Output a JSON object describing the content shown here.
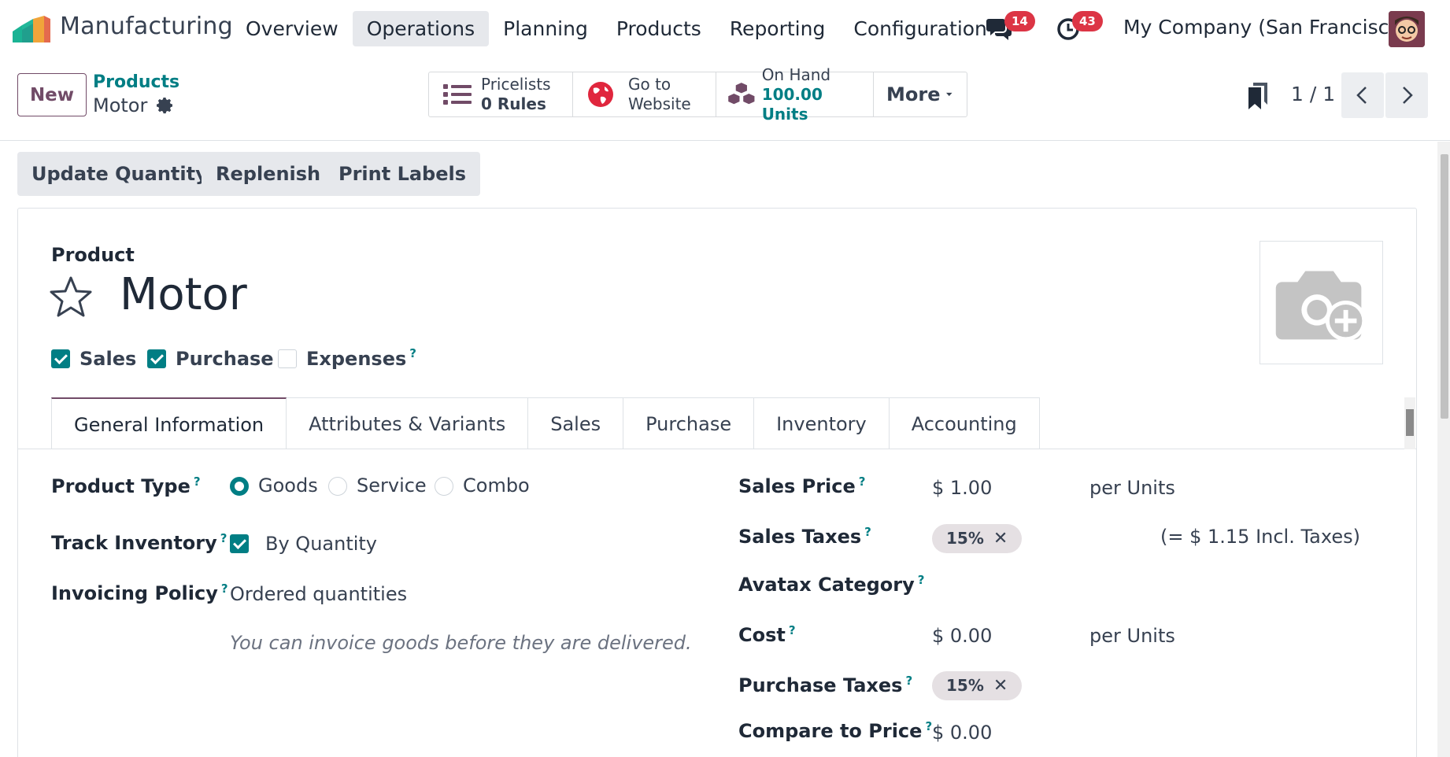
{
  "navbar": {
    "app_name": "Manufacturing",
    "menu": [
      {
        "label": "Overview",
        "active": false
      },
      {
        "label": "Operations",
        "active": true
      },
      {
        "label": "Planning",
        "active": false
      },
      {
        "label": "Products",
        "active": false
      },
      {
        "label": "Reporting",
        "active": false
      },
      {
        "label": "Configuration",
        "active": false
      }
    ],
    "messages_badge": "14",
    "activities_badge": "43",
    "company": "My Company (San Francisco)"
  },
  "control": {
    "new_label": "New",
    "breadcrumb_parent": "Products",
    "breadcrumb_current": "Motor",
    "smart_buttons": {
      "pricelists": {
        "line1": "Pricelists",
        "line2": "0  Rules"
      },
      "website": {
        "line1": "Go to",
        "line2": "Website"
      },
      "on_hand": {
        "line1": "On Hand",
        "line2": "100.00 Units"
      },
      "more": "More"
    },
    "pager": "1 / 1"
  },
  "actions": {
    "update_quantity": "Update Quantity",
    "replenish": "Replenish",
    "print_labels": "Print Labels"
  },
  "form": {
    "product_label": "Product",
    "name": "Motor",
    "checkboxes": [
      {
        "label": "Sales",
        "checked": true
      },
      {
        "label": "Purchase",
        "checked": true
      },
      {
        "label": "Expenses",
        "checked": false,
        "help": "?"
      }
    ],
    "tabs": [
      "General Information",
      "Attributes & Variants",
      "Sales",
      "Purchase",
      "Inventory",
      "Accounting"
    ],
    "help_mark": "?",
    "left": {
      "product_type_label": "Product Type",
      "product_type_options": [
        "Goods",
        "Service",
        "Combo"
      ],
      "product_type_selected": "Goods",
      "track_inventory_label": "Track Inventory",
      "track_inventory_value": "By Quantity",
      "invoicing_policy_label": "Invoicing Policy",
      "invoicing_policy_value": "Ordered quantities",
      "invoicing_help": "You can invoice goods before they are delivered."
    },
    "right": {
      "sales_price_label": "Sales Price",
      "sales_price_value": "$ 1.00",
      "sales_price_unit": "per Units",
      "sales_taxes_label": "Sales Taxes",
      "sales_taxes_tag": "15%",
      "sales_taxes_incl": "(= $ 1.15 Incl. Taxes)",
      "avatax_label": "Avatax Category",
      "cost_label": "Cost",
      "cost_value": "$ 0.00",
      "cost_unit": "per Units",
      "purchase_taxes_label": "Purchase Taxes",
      "purchase_taxes_tag": "15%",
      "compare_label": "Compare to Price",
      "compare_value": "$ 0.00"
    }
  },
  "colors": {
    "brand": "#714b67",
    "accent": "#017e84",
    "badge": "#dc3545"
  }
}
